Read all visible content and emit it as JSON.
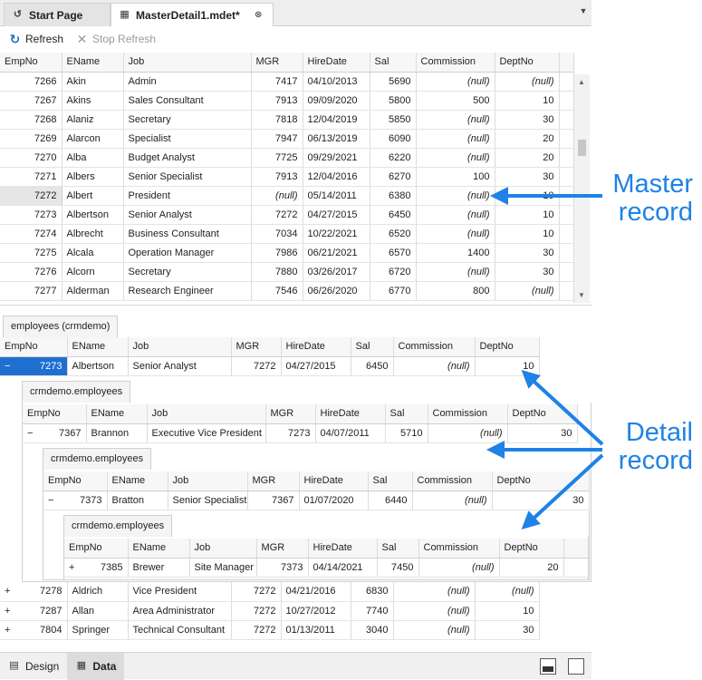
{
  "tabs": [
    {
      "label": "Start Page",
      "icon": "start-page-icon"
    },
    {
      "label": "MasterDetail1.mdet*",
      "icon": "grid-document-icon"
    }
  ],
  "toolbar": {
    "refresh": "Refresh",
    "stop_refresh": "Stop Refresh"
  },
  "master": {
    "columns": [
      "EmpNo",
      "EName",
      "Job",
      "MGR",
      "HireDate",
      "Sal",
      "Commission",
      "DeptNo"
    ],
    "rows": [
      [
        "7266",
        "Akin",
        "Admin",
        "7417",
        "04/10/2013",
        "5690",
        "(null)",
        "(null)"
      ],
      [
        "7267",
        "Akins",
        "Sales Consultant",
        "7913",
        "09/09/2020",
        "5800",
        "500",
        "10"
      ],
      [
        "7268",
        "Alaniz",
        "Secretary",
        "7818",
        "12/04/2019",
        "5850",
        "(null)",
        "30"
      ],
      [
        "7269",
        "Alarcon",
        "Specialist",
        "7947",
        "06/13/2019",
        "6090",
        "(null)",
        "20"
      ],
      [
        "7270",
        "Alba",
        "Budget Analyst",
        "7725",
        "09/29/2021",
        "6220",
        "(null)",
        "20"
      ],
      [
        "7271",
        "Albers",
        "Senior Specialist",
        "7913",
        "12/04/2016",
        "6270",
        "100",
        "30"
      ],
      [
        "7272",
        "Albert",
        "President",
        "(null)",
        "05/14/2011",
        "6380",
        "(null)",
        "10"
      ],
      [
        "7273",
        "Albertson",
        "Senior Analyst",
        "7272",
        "04/27/2015",
        "6450",
        "(null)",
        "10"
      ],
      [
        "7274",
        "Albrecht",
        "Business Consultant",
        "7034",
        "10/22/2021",
        "6520",
        "(null)",
        "10"
      ],
      [
        "7275",
        "Alcala",
        "Operation Manager",
        "7986",
        "06/21/2021",
        "6570",
        "1400",
        "30"
      ],
      [
        "7276",
        "Alcorn",
        "Secretary",
        "7880",
        "03/26/2017",
        "6720",
        "(null)",
        "30"
      ],
      [
        "7277",
        "Alderman",
        "Research Engineer",
        "7546",
        "06/26/2020",
        "6770",
        "800",
        "(null)"
      ]
    ]
  },
  "detail": {
    "tab": "employees (crmdemo)",
    "columns": [
      "EmpNo",
      "EName",
      "Job",
      "MGR",
      "HireDate",
      "Sal",
      "Commission",
      "DeptNo"
    ],
    "expanded_row": [
      "7273",
      "Albertson",
      "Senior Analyst",
      "7272",
      "04/27/2015",
      "6450",
      "(null)",
      "10"
    ],
    "level2": {
      "tab": "crmdemo.employees",
      "columns": [
        "EmpNo",
        "EName",
        "Job",
        "MGR",
        "HireDate",
        "Sal",
        "Commission",
        "DeptNo"
      ],
      "row": [
        "7367",
        "Brannon",
        "Executive Vice President",
        "7273",
        "04/07/2011",
        "5710",
        "(null)",
        "30"
      ]
    },
    "level3": {
      "tab": "crmdemo.employees",
      "columns": [
        "EmpNo",
        "EName",
        "Job",
        "MGR",
        "HireDate",
        "Sal",
        "Commission",
        "DeptNo"
      ],
      "row": [
        "7373",
        "Bratton",
        "Senior Specialist",
        "7367",
        "01/07/2020",
        "6440",
        "(null)",
        "30"
      ]
    },
    "level4": {
      "tab": "crmdemo.employees",
      "columns": [
        "EmpNo",
        "EName",
        "Job",
        "MGR",
        "HireDate",
        "Sal",
        "Commission",
        "DeptNo"
      ],
      "row": [
        "7385",
        "Brewer",
        "Site Manager",
        "7373",
        "04/14/2021",
        "7450",
        "(null)",
        "20"
      ]
    },
    "collapsed_rows": [
      [
        "7278",
        "Aldrich",
        "Vice President",
        "7272",
        "04/21/2016",
        "6830",
        "(null)",
        "(null)"
      ],
      [
        "7287",
        "Allan",
        "Area Administrator",
        "7272",
        "10/27/2012",
        "7740",
        "(null)",
        "10"
      ],
      [
        "7804",
        "Springer",
        "Technical Consultant",
        "7272",
        "01/13/2011",
        "3040",
        "(null)",
        "30"
      ]
    ]
  },
  "bottom_tabs": [
    "Design",
    "Data"
  ],
  "annotations": {
    "master": [
      "Master",
      "record"
    ],
    "detail": [
      "Detail",
      "record"
    ]
  },
  "colors": {
    "accent": "#1e82e6",
    "selection": "#1f6fd1"
  }
}
